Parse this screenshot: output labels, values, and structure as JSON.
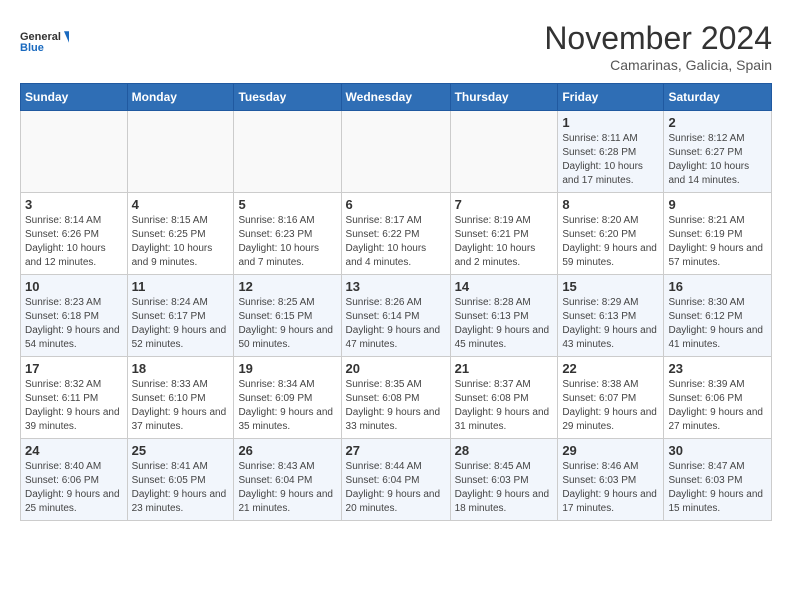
{
  "logo": {
    "line1": "General",
    "line2": "Blue"
  },
  "title": "November 2024",
  "location": "Camarinas, Galicia, Spain",
  "days_of_week": [
    "Sunday",
    "Monday",
    "Tuesday",
    "Wednesday",
    "Thursday",
    "Friday",
    "Saturday"
  ],
  "weeks": [
    [
      {
        "day": "",
        "info": ""
      },
      {
        "day": "",
        "info": ""
      },
      {
        "day": "",
        "info": ""
      },
      {
        "day": "",
        "info": ""
      },
      {
        "day": "",
        "info": ""
      },
      {
        "day": "1",
        "info": "Sunrise: 8:11 AM\nSunset: 6:28 PM\nDaylight: 10 hours and 17 minutes."
      },
      {
        "day": "2",
        "info": "Sunrise: 8:12 AM\nSunset: 6:27 PM\nDaylight: 10 hours and 14 minutes."
      }
    ],
    [
      {
        "day": "3",
        "info": "Sunrise: 8:14 AM\nSunset: 6:26 PM\nDaylight: 10 hours and 12 minutes."
      },
      {
        "day": "4",
        "info": "Sunrise: 8:15 AM\nSunset: 6:25 PM\nDaylight: 10 hours and 9 minutes."
      },
      {
        "day": "5",
        "info": "Sunrise: 8:16 AM\nSunset: 6:23 PM\nDaylight: 10 hours and 7 minutes."
      },
      {
        "day": "6",
        "info": "Sunrise: 8:17 AM\nSunset: 6:22 PM\nDaylight: 10 hours and 4 minutes."
      },
      {
        "day": "7",
        "info": "Sunrise: 8:19 AM\nSunset: 6:21 PM\nDaylight: 10 hours and 2 minutes."
      },
      {
        "day": "8",
        "info": "Sunrise: 8:20 AM\nSunset: 6:20 PM\nDaylight: 9 hours and 59 minutes."
      },
      {
        "day": "9",
        "info": "Sunrise: 8:21 AM\nSunset: 6:19 PM\nDaylight: 9 hours and 57 minutes."
      }
    ],
    [
      {
        "day": "10",
        "info": "Sunrise: 8:23 AM\nSunset: 6:18 PM\nDaylight: 9 hours and 54 minutes."
      },
      {
        "day": "11",
        "info": "Sunrise: 8:24 AM\nSunset: 6:17 PM\nDaylight: 9 hours and 52 minutes."
      },
      {
        "day": "12",
        "info": "Sunrise: 8:25 AM\nSunset: 6:15 PM\nDaylight: 9 hours and 50 minutes."
      },
      {
        "day": "13",
        "info": "Sunrise: 8:26 AM\nSunset: 6:14 PM\nDaylight: 9 hours and 47 minutes."
      },
      {
        "day": "14",
        "info": "Sunrise: 8:28 AM\nSunset: 6:13 PM\nDaylight: 9 hours and 45 minutes."
      },
      {
        "day": "15",
        "info": "Sunrise: 8:29 AM\nSunset: 6:13 PM\nDaylight: 9 hours and 43 minutes."
      },
      {
        "day": "16",
        "info": "Sunrise: 8:30 AM\nSunset: 6:12 PM\nDaylight: 9 hours and 41 minutes."
      }
    ],
    [
      {
        "day": "17",
        "info": "Sunrise: 8:32 AM\nSunset: 6:11 PM\nDaylight: 9 hours and 39 minutes."
      },
      {
        "day": "18",
        "info": "Sunrise: 8:33 AM\nSunset: 6:10 PM\nDaylight: 9 hours and 37 minutes."
      },
      {
        "day": "19",
        "info": "Sunrise: 8:34 AM\nSunset: 6:09 PM\nDaylight: 9 hours and 35 minutes."
      },
      {
        "day": "20",
        "info": "Sunrise: 8:35 AM\nSunset: 6:08 PM\nDaylight: 9 hours and 33 minutes."
      },
      {
        "day": "21",
        "info": "Sunrise: 8:37 AM\nSunset: 6:08 PM\nDaylight: 9 hours and 31 minutes."
      },
      {
        "day": "22",
        "info": "Sunrise: 8:38 AM\nSunset: 6:07 PM\nDaylight: 9 hours and 29 minutes."
      },
      {
        "day": "23",
        "info": "Sunrise: 8:39 AM\nSunset: 6:06 PM\nDaylight: 9 hours and 27 minutes."
      }
    ],
    [
      {
        "day": "24",
        "info": "Sunrise: 8:40 AM\nSunset: 6:06 PM\nDaylight: 9 hours and 25 minutes."
      },
      {
        "day": "25",
        "info": "Sunrise: 8:41 AM\nSunset: 6:05 PM\nDaylight: 9 hours and 23 minutes."
      },
      {
        "day": "26",
        "info": "Sunrise: 8:43 AM\nSunset: 6:04 PM\nDaylight: 9 hours and 21 minutes."
      },
      {
        "day": "27",
        "info": "Sunrise: 8:44 AM\nSunset: 6:04 PM\nDaylight: 9 hours and 20 minutes."
      },
      {
        "day": "28",
        "info": "Sunrise: 8:45 AM\nSunset: 6:03 PM\nDaylight: 9 hours and 18 minutes."
      },
      {
        "day": "29",
        "info": "Sunrise: 8:46 AM\nSunset: 6:03 PM\nDaylight: 9 hours and 17 minutes."
      },
      {
        "day": "30",
        "info": "Sunrise: 8:47 AM\nSunset: 6:03 PM\nDaylight: 9 hours and 15 minutes."
      }
    ]
  ]
}
